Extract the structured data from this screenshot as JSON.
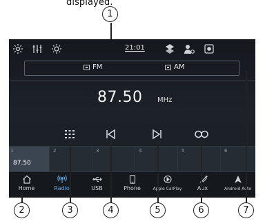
{
  "caption": "displayed.",
  "status_bar": {
    "time": "21:01",
    "icons": [
      "gear-icon",
      "equalizer-icon",
      "brightness-icon",
      "navigation-icon",
      "user-settings-icon",
      "camera-icon"
    ]
  },
  "bands": [
    {
      "label": "FM",
      "icon": "band-icon"
    },
    {
      "label": "AM",
      "icon": "band-icon"
    }
  ],
  "tuner": {
    "frequency": "87.50",
    "unit": "MHz"
  },
  "controls": [
    "keypad-icon",
    "seek-back-icon",
    "seek-forward-icon",
    "loop-icon"
  ],
  "presets": [
    {
      "number": "1",
      "value": "87.50",
      "active": true
    },
    {
      "number": "2",
      "value": ""
    },
    {
      "number": "3",
      "value": ""
    },
    {
      "number": "4",
      "value": ""
    },
    {
      "number": "5",
      "value": ""
    },
    {
      "number": "6",
      "value": ""
    }
  ],
  "nav": [
    {
      "label": "Home",
      "icon": "home-icon"
    },
    {
      "label": "Radio",
      "icon": "radio-icon",
      "active": true
    },
    {
      "label": "USB",
      "icon": "usb-icon"
    },
    {
      "label": "Phone",
      "icon": "phone-icon"
    },
    {
      "label": "Apple CarPlay",
      "icon": "carplay-icon"
    },
    {
      "label": "Aux",
      "icon": "aux-icon"
    },
    {
      "label": "Android Auto",
      "icon": "android-auto-icon"
    }
  ],
  "callouts": [
    "1",
    "2",
    "3",
    "4",
    "5",
    "6",
    "7"
  ],
  "colors": {
    "screen_bg": "#1a1e24",
    "active_nav": "#62a7e8",
    "preset_active": "#3b4552"
  }
}
